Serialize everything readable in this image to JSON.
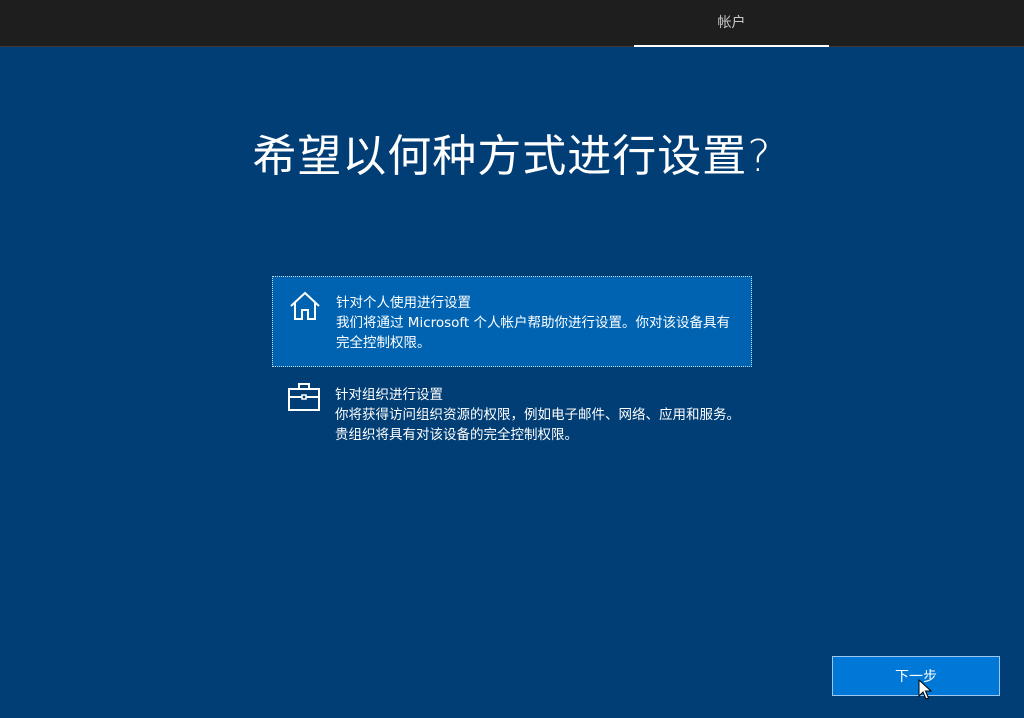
{
  "header": {
    "tabs": [
      {
        "label": "帐户",
        "active": true
      }
    ]
  },
  "main": {
    "title": "希望以何种方式进行设置?",
    "options": [
      {
        "id": "personal",
        "icon": "home-icon",
        "title": "针对个人使用进行设置",
        "description": "我们将通过 Microsoft 个人帐户帮助你进行设置。你对该设备具有完全控制权限。",
        "selected": true
      },
      {
        "id": "organization",
        "icon": "briefcase-icon",
        "title": "针对组织进行设置",
        "description": "你将获得访问组织资源的权限，例如电子邮件、网络、应用和服务。贵组织将具有对该设备的完全控制权限。",
        "selected": false
      }
    ]
  },
  "footer": {
    "next_label": "下一步"
  },
  "colors": {
    "background": "#003e75",
    "selected_option": "#0063b1",
    "button": "#0078d7",
    "topbar": "#1e1e1e"
  }
}
